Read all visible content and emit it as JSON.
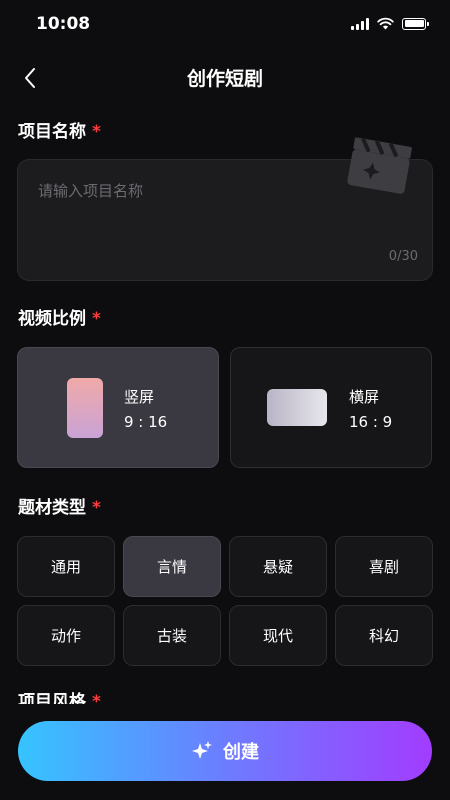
{
  "status_bar": {
    "time": "10:08"
  },
  "nav": {
    "title": "创作短剧"
  },
  "project_name": {
    "label": "项目名称",
    "required_mark": "*",
    "placeholder": "请输入项目名称",
    "value": "",
    "counter": "0/30"
  },
  "aspect_ratio": {
    "label": "视频比例",
    "required_mark": "*",
    "options": [
      {
        "name": "竖屏",
        "ratio": "9 : 16",
        "selected": true
      },
      {
        "name": "横屏",
        "ratio": "16 : 9",
        "selected": false
      }
    ]
  },
  "genre": {
    "label": "题材类型",
    "required_mark": "*",
    "options": [
      "通用",
      "言情",
      "悬疑",
      "喜剧",
      "动作",
      "古装",
      "现代",
      "科幻"
    ],
    "selected": "言情"
  },
  "style": {
    "label": "项目风格",
    "required_mark": "*"
  },
  "create_button": {
    "label": "创建"
  },
  "colors": {
    "background": "#0d0d0f",
    "card": "#1c1c1f",
    "selected_card": "#3a3840",
    "required": "#ff3b3b",
    "gradient_start": "#35c4ff",
    "gradient_end": "#a23cff"
  },
  "icons": [
    "back-chevron-icon",
    "signal-icon",
    "wifi-icon",
    "battery-icon",
    "clapperboard-icon",
    "sparkle-icon"
  ]
}
